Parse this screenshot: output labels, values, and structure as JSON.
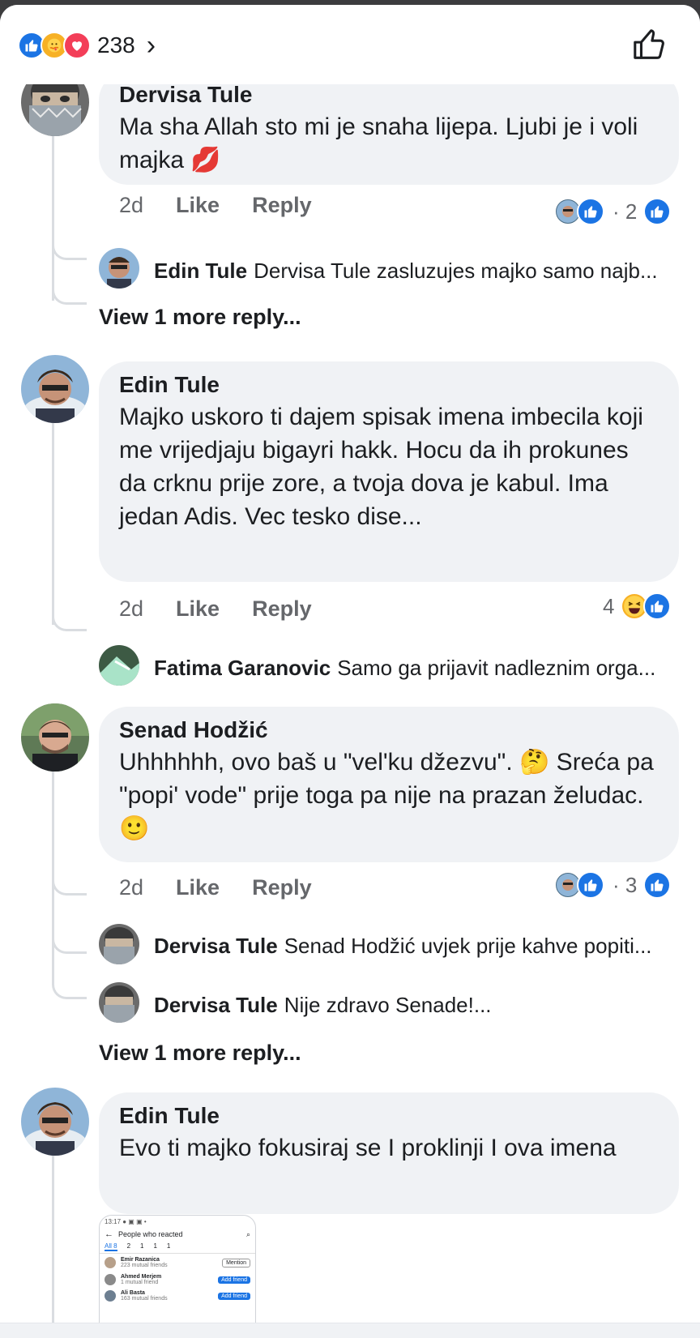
{
  "reactions_bar": {
    "count": "238",
    "chevron": "›"
  },
  "comments": [
    {
      "author": "Dervisa Tule",
      "text": "Ma sha Allah sto mi je snaha lijepa. Ljubi je i voli majka 💋",
      "time": "2d",
      "like": "Like",
      "reply": "Reply",
      "reaction_count": "· 2"
    },
    {
      "author": "Edin Tule",
      "text": "Majko uskoro ti dajem spisak imena imbecila koji me vrijedjaju bigayri hakk. Hocu da ih prokunes da crknu prije zore, a tvoja dova je kabul. Ima jedan Adis. Vec tesko dise...",
      "time": "2d",
      "like": "Like",
      "reply": "Reply",
      "reaction_count": "4"
    },
    {
      "author": "Senad Hodžić",
      "text": "Uhhhhhh, ovo baš u \"vel'ku džezvu\". 🤔 Sreća pa \"popi' vode\" prije toga pa nije na prazan želudac. 🙂",
      "time": "2d",
      "like": "Like",
      "reply": "Reply",
      "reaction_count": "· 3"
    },
    {
      "author": "Edin Tule",
      "text": "Evo ti majko fokusiraj se I proklinji I ova imena"
    }
  ],
  "replies": [
    {
      "author": "Edin Tule",
      "text": "Dervisa Tule zasluzujes majko samo najb..."
    },
    {
      "author": "Fatima Garanovic",
      "text": "Samo ga prijavit nadleznim orga..."
    },
    {
      "author": "Dervisa Tule",
      "text": "Senad Hodžić uvjek prije kahve popiti..."
    },
    {
      "author": "Dervisa Tule",
      "text": "Nije zdravo Senade!..."
    }
  ],
  "view_more": [
    "View 1 more reply...",
    "View 1 more reply..."
  ],
  "screenshot_preview": {
    "status": "13:17 ● ▣ ▣ •",
    "title": "People who reacted",
    "tabs": [
      "All 8",
      "2",
      "1",
      "1",
      "1"
    ],
    "people": [
      {
        "name": "Emir Razanica",
        "sub": "223 mutual friends",
        "action": "Mention"
      },
      {
        "name": "Ahmed Merjem",
        "sub": "1 mutual friend",
        "action": "Add friend"
      },
      {
        "name": "Ali Basta",
        "sub": "163 mutual friends",
        "action": "Add friend"
      }
    ]
  },
  "colors": {
    "accent": "#1b74e4",
    "bubble": "#f0f2f5",
    "meta": "#65676b"
  }
}
